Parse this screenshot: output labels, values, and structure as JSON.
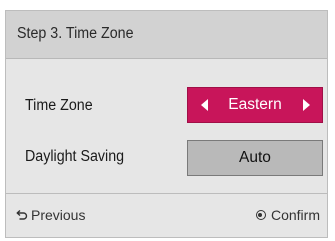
{
  "header": {
    "title": "Step 3. Time Zone"
  },
  "settings": {
    "time_zone": {
      "label": "Time Zone",
      "value": "Eastern",
      "left_icon": "arrow-left-icon",
      "right_icon": "arrow-right-icon",
      "highlight_color": "#c8155a"
    },
    "daylight_saving": {
      "label": "Daylight Saving",
      "value": "Auto"
    }
  },
  "footer": {
    "previous_label": "Previous",
    "previous_icon": "return-arrow-icon",
    "confirm_label": "Confirm",
    "confirm_icon": "ok-button-icon"
  }
}
